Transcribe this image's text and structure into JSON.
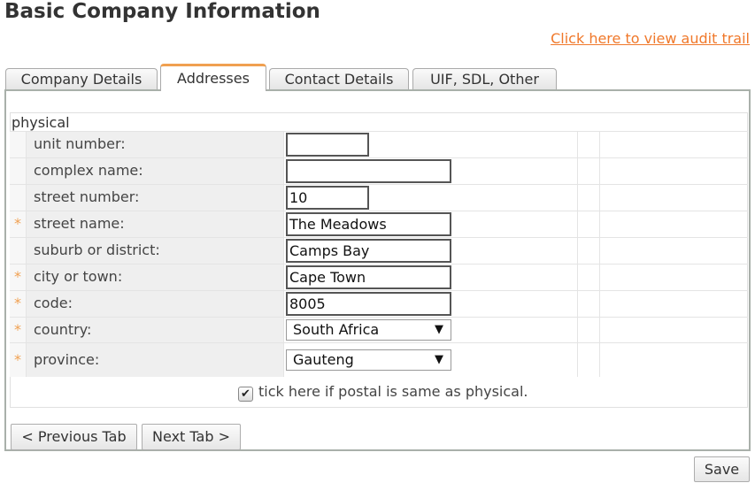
{
  "page": {
    "title": "Basic Company Information",
    "audit_link": "Click here to view audit trail"
  },
  "tabs": [
    {
      "label": "Company Details"
    },
    {
      "label": "Addresses",
      "active": true
    },
    {
      "label": "Contact Details"
    },
    {
      "label": "UIF, SDL, Other"
    }
  ],
  "section": {
    "title": "physical"
  },
  "fields": {
    "unit_number": {
      "label": "unit number:",
      "value": ""
    },
    "complex_name": {
      "label": "complex name:",
      "value": ""
    },
    "street_number": {
      "label": "street number:",
      "value": "10"
    },
    "street_name": {
      "label": "street name:",
      "value": "The Meadows",
      "required": "*"
    },
    "suburb": {
      "label": "suburb or district:",
      "value": "Camps Bay"
    },
    "city": {
      "label": "city or town:",
      "value": "Cape Town",
      "required": "*"
    },
    "code": {
      "label": "code:",
      "value": "8005",
      "required": "*"
    },
    "country": {
      "label": "country:",
      "value": "South Africa",
      "required": "*"
    },
    "province": {
      "label": "province:",
      "value": "Gauteng",
      "required": "*"
    }
  },
  "postal_same": {
    "label": "tick here if postal is same as physical.",
    "checked": true,
    "mark": "✔"
  },
  "buttons": {
    "previous": "< Previous Tab",
    "next": "Next Tab >",
    "save": "Save"
  },
  "icons": {
    "dropdown": "▼",
    "dropdown_icon_name": "chevron-down-icon",
    "checkmark_icon_name": "checkmark-icon"
  },
  "colors": {
    "accent": "#f0782a",
    "tab_highlight": "#f0a050",
    "required": "#f0a050"
  }
}
